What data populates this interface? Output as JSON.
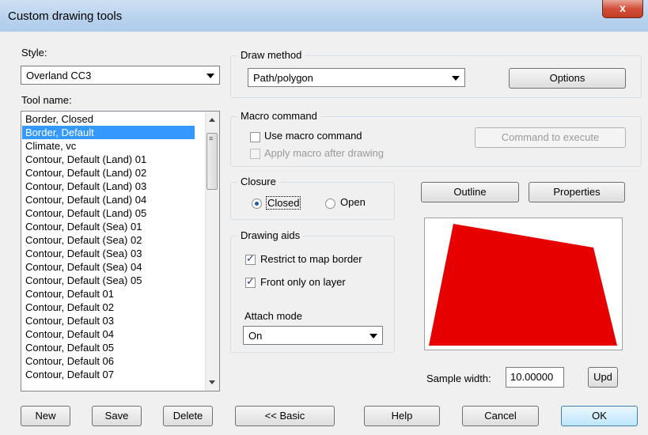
{
  "window": {
    "title": "Custom drawing tools",
    "close_label": "x"
  },
  "style": {
    "label": "Style:",
    "value": "Overland CC3"
  },
  "tool_name": {
    "label": "Tool name:",
    "items": [
      "Border, Closed",
      "Border, Default",
      "Climate, vc",
      "Contour, Default (Land) 01",
      "Contour, Default (Land) 02",
      "Contour, Default (Land) 03",
      "Contour, Default (Land) 04",
      "Contour, Default (Land) 05",
      "Contour, Default (Sea) 01",
      "Contour, Default (Sea) 02",
      "Contour, Default (Sea) 03",
      "Contour, Default (Sea) 04",
      "Contour, Default (Sea) 05",
      "Contour, Default 01",
      "Contour, Default 02",
      "Contour, Default 03",
      "Contour, Default 04",
      "Contour, Default 05",
      "Contour, Default 06",
      "Contour, Default 07"
    ],
    "selected": "Border, Default"
  },
  "draw_method": {
    "group_label": "Draw method",
    "value": "Path/polygon",
    "options_button": "Options"
  },
  "macro": {
    "group_label": "Macro command",
    "use_macro_label": "Use macro command",
    "use_macro_checked": false,
    "apply_after_label": "Apply macro after drawing",
    "apply_after_checked": false,
    "command_button": "Command to execute"
  },
  "closure": {
    "group_label": "Closure",
    "closed_label": "Closed",
    "open_label": "Open",
    "selected": "Closed"
  },
  "drawing_aids": {
    "group_label": "Drawing aids",
    "restrict_label": "Restrict to map border",
    "restrict_checked": true,
    "front_label": "Front only on layer",
    "front_checked": true,
    "attach_label": "Attach mode",
    "attach_value": "On"
  },
  "outline_button": "Outline",
  "properties_button": "Properties",
  "preview": {
    "fill_color": "#e60000"
  },
  "sample_width": {
    "label": "Sample width:",
    "value": "10.00000",
    "update_button": "Upd"
  },
  "footer": {
    "new": "New",
    "save": "Save",
    "delete": "Delete",
    "basic": "<< Basic",
    "help": "Help",
    "cancel": "Cancel",
    "ok": "OK"
  }
}
